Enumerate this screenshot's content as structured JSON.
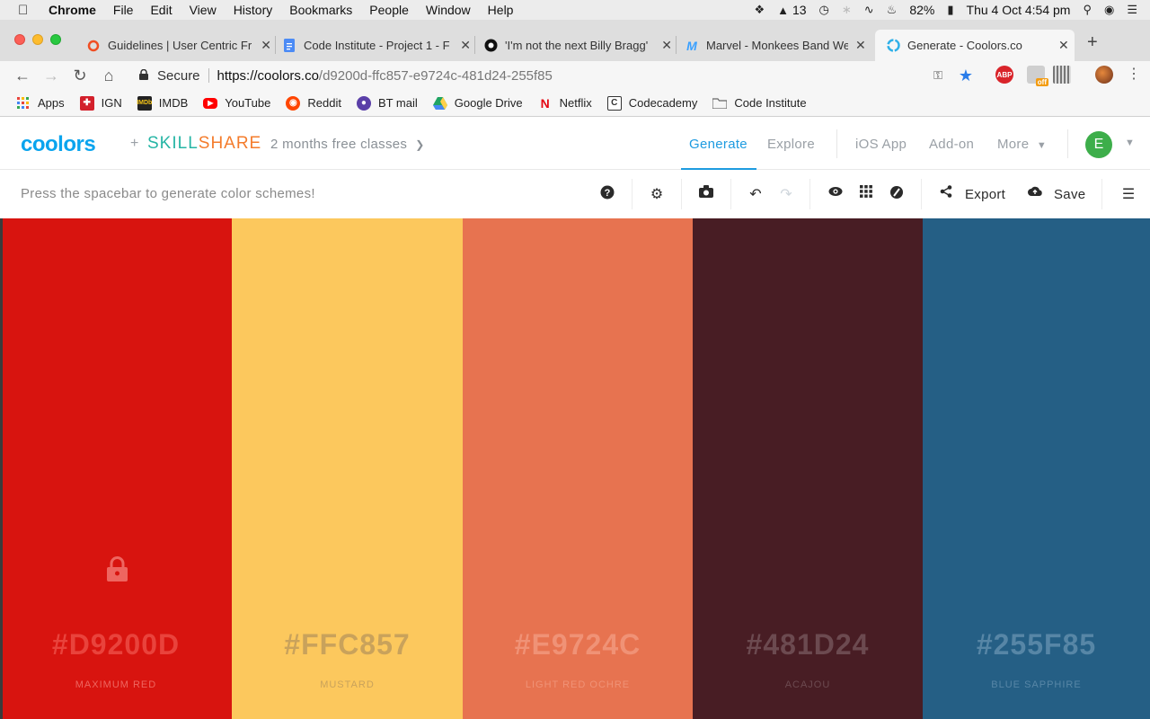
{
  "menubar": {
    "app": "Chrome",
    "items": [
      "File",
      "Edit",
      "View",
      "History",
      "Bookmarks",
      "People",
      "Window",
      "Help"
    ],
    "adobe_count": "13",
    "battery": "82%",
    "clock": "Thu 4 Oct  4:54 pm"
  },
  "tabs": [
    {
      "title": "Guidelines | User Centric Fr",
      "favicon": "circle-icon",
      "color": "#f04e23"
    },
    {
      "title": "Code Institute - Project 1 - F",
      "favicon": "docs-icon",
      "color": "#4c8bf5"
    },
    {
      "title": "'I'm not the next Billy Bragg'",
      "favicon": "github-icon",
      "color": "#111111"
    },
    {
      "title": "Marvel - Monkees Band Wel",
      "favicon": "marvel-icon",
      "color": "#3aa0ff"
    },
    {
      "title": "Generate - Coolors.co",
      "favicon": "coolors-icon",
      "color": "#2fb0e8"
    }
  ],
  "omnibox": {
    "secure_label": "Secure",
    "url_host": "https://coolors.co",
    "url_path": "/d9200d-ffc857-e9724c-481d24-255f85"
  },
  "extensions": {
    "abp_label": "ABP",
    "off_label": "off"
  },
  "bookmarks": [
    {
      "label": "Apps",
      "icon": "apps-grid-icon"
    },
    {
      "label": "IGN",
      "icon": "ign-icon",
      "color": "#d3202b"
    },
    {
      "label": "IMDB",
      "icon": "imdb-icon",
      "color": "#222222"
    },
    {
      "label": "YouTube",
      "icon": "youtube-icon",
      "color": "#ff0000"
    },
    {
      "label": "Reddit",
      "icon": "reddit-icon",
      "color": "#ff4500"
    },
    {
      "label": "BT mail",
      "icon": "bt-icon",
      "color": "#5a3fa8"
    },
    {
      "label": "Google Drive",
      "icon": "drive-icon",
      "color": "#1fa463"
    },
    {
      "label": "Netflix",
      "icon": "netflix-icon",
      "color": "#e50914"
    },
    {
      "label": "Codecademy",
      "icon": "codecademy-icon",
      "color": "#333333"
    },
    {
      "label": "Code Institute",
      "icon": "folder-icon",
      "color": "#777777"
    }
  ],
  "header": {
    "logo": "coolors",
    "plus": "+",
    "skillshare_a": "SKILL",
    "skillshare_b": "SHARE",
    "promo": "2 months free classes",
    "nav": [
      "Generate",
      "Explore",
      "iOS App",
      "Add-on",
      "More"
    ],
    "avatar_initial": "E"
  },
  "hint": "Press the spacebar to generate color schemes!",
  "toolbar": {
    "export_label": "Export",
    "save_label": "Save"
  },
  "colors": {
    "accent": "#1e9be0",
    "coolors_blue": "#0aa4ee"
  },
  "palette": [
    {
      "hex": "#D9200D",
      "name": "MAXIMUM RED",
      "bg": "#d8140f",
      "text": "#e9433c",
      "label": "#ee6660",
      "locked": true
    },
    {
      "hex": "#FFC857",
      "name": "MUSTARD",
      "bg": "#fcc85d",
      "text": "#c9a25b",
      "label": "#c9a25b",
      "locked": false
    },
    {
      "hex": "#E9724C",
      "name": "LIGHT RED OCHRE",
      "bg": "#e77350",
      "text": "#f09276",
      "label": "#f09276",
      "locked": false
    },
    {
      "hex": "#481D24",
      "name": "ACAJOU",
      "bg": "#481d24",
      "text": "#6c4a50",
      "label": "#6c4a50",
      "locked": false
    },
    {
      "hex": "#255F85",
      "name": "BLUE SAPPHIRE",
      "bg": "#255f85",
      "text": "#5786a6",
      "label": "#5786a6",
      "locked": false
    }
  ]
}
